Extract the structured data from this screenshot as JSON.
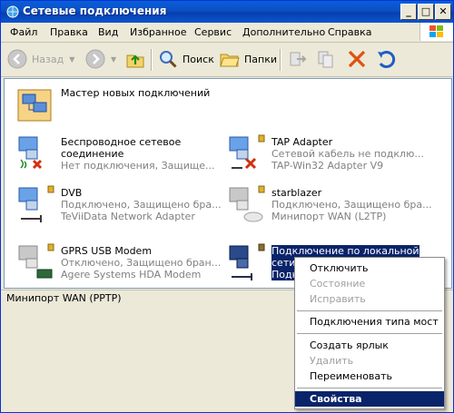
{
  "window": {
    "title": "Сетевые подключения",
    "buttons": {
      "minimize": "_",
      "maximize": "□",
      "close": "✕"
    }
  },
  "menubar": {
    "items": [
      "Файл",
      "Правка",
      "Вид",
      "Избранное",
      "Сервис",
      "Дополнительно",
      "Справка"
    ]
  },
  "toolbar": {
    "back": "Назад",
    "search": "Поиск",
    "folders": "Папки"
  },
  "connections": [
    {
      "name": "Мастер новых подключений",
      "name2": "",
      "sub1": "",
      "sub2": "",
      "icon": "wizard-icon"
    },
    {
      "name": "Беспроводное сетевое",
      "name2": "соединение",
      "sub1": "Нет подключения, Защище...",
      "sub2": "",
      "icon": "wireless-disconnected-icon"
    },
    {
      "name": "TAP Adapter",
      "name2": "",
      "sub1": "Сетевой кабель не подклю...",
      "sub2": "TAP-Win32 Adapter V9",
      "icon": "lan-disconnected-icon"
    },
    {
      "name": "DVB",
      "name2": "",
      "sub1": "Подключено, Защищено бра...",
      "sub2": "TeViiData Network Adapter",
      "icon": "lan-connected-icon"
    },
    {
      "name": "starblazer",
      "name2": "",
      "sub1": "Подключено, Защищено бра...",
      "sub2": "Минипорт WAN (L2TP)",
      "icon": "vpn-icon"
    },
    {
      "name": "GPRS USB Modem",
      "name2": "",
      "sub1": "Отключено, Защищено бран...",
      "sub2": "Agere Systems HDA Modem",
      "icon": "modem-icon"
    },
    {
      "name": "Подключение по локальной",
      "name2": "сети",
      "sub1": "Подкл",
      "sub2": "",
      "icon": "lan-selected-icon"
    }
  ],
  "statusbar": {
    "text": "Минипорт WAN (PPTP)"
  },
  "context_menu": {
    "items": [
      {
        "label": "Отключить",
        "enabled": true
      },
      {
        "label": "Состояние",
        "enabled": false
      },
      {
        "label": "Исправить",
        "enabled": false
      },
      {
        "label": "Подключения типа мост",
        "enabled": true
      },
      {
        "label": "Создать ярлык",
        "enabled": true
      },
      {
        "label": "Удалить",
        "enabled": false
      },
      {
        "label": "Переименовать",
        "enabled": true
      },
      {
        "label": "Свойства",
        "enabled": true,
        "highlighted": true
      }
    ]
  },
  "colors": {
    "titlebar": "#0b55cd",
    "selection": "#0a246a",
    "disabled_text": "#a0a0a0"
  }
}
